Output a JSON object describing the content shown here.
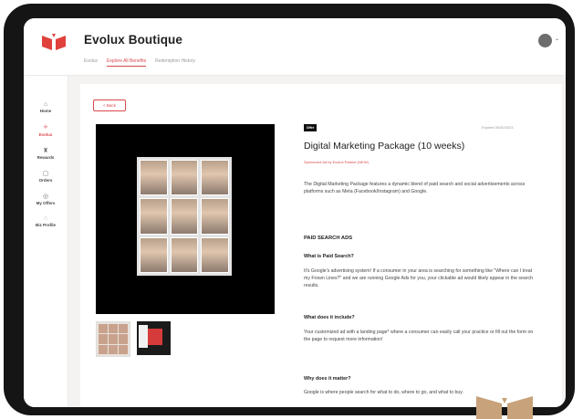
{
  "app": {
    "brand": "Evolux Boutique"
  },
  "tabs": [
    {
      "label": "Evolux"
    },
    {
      "label": "Explore All Benefits"
    },
    {
      "label": "Redemption History"
    }
  ],
  "sidebar": {
    "items": [
      {
        "label": "Home",
        "icon": "home-icon",
        "glyph": "⌂"
      },
      {
        "label": "Evolux",
        "icon": "evolux-icon",
        "glyph": "⟡"
      },
      {
        "label": "Rewards",
        "icon": "rewards-icon",
        "glyph": "♜"
      },
      {
        "label": "Orders",
        "icon": "orders-icon",
        "glyph": "▢"
      },
      {
        "label": "My Offers",
        "icon": "offers-icon",
        "glyph": "◎"
      },
      {
        "label": "Biz Profile",
        "icon": "profile-icon",
        "glyph": "◌"
      }
    ]
  },
  "detail": {
    "back_label": "< Back",
    "tag": "Offer",
    "expires": "Expires 06/30/2023",
    "title": "Digital Marketing Package (10 weeks)",
    "sponsor": "Sponsored Ad by Evolux Partner (NEW)",
    "description": "The Digital Marketing Package features a dynamic blend of paid search and social advertisements across platforms such as Meta (Facebook/Instagram) and Google.",
    "section_heading": "PAID SEARCH ADS",
    "q1": "What is Paid Search?",
    "a1": "It's Google's advertising system! If a consumer in your area is searching for something like \"Where can I treat my Frown Lines?\" and we are running Google Ads for you, your clickable ad would likely appear in the search results.",
    "q2": "What does it include?",
    "a2": "Your customized ad with a landing page* where a consumer can easily call your practice or fill out the form on the page to request more information!",
    "q3": "Why does it matter?",
    "a3": "Google is where people search for what to do, where to go, and what to buy."
  },
  "colors": {
    "accent": "#d9494c",
    "frame": "#151515",
    "logo_tan": "#c8a27a"
  }
}
